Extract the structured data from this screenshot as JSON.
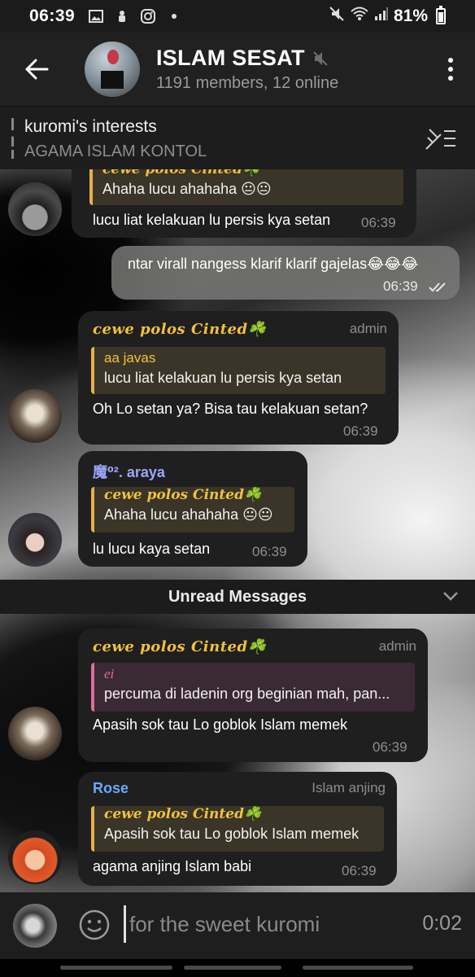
{
  "status_bar": {
    "time": "06:39",
    "icons_left": [
      "image-icon",
      "android-icon",
      "instagram-icon",
      "dot-icon"
    ],
    "battery": "81%"
  },
  "header": {
    "title": "ISLAM SESAT",
    "subtitle": "1191 members, 12 online"
  },
  "pinned": {
    "title": "kuromi's interests",
    "text": "AGAMA ISLAM KONTOL"
  },
  "messages": [
    {
      "sender": "",
      "reply_name": "cewe polos Cinted☘️",
      "reply_text": "Ahaha lucu ahahaha 😐😐",
      "text": "lucu liat kelakuan lu persis kya setan",
      "time": "06:39"
    },
    {
      "outgoing": true,
      "text": "ntar virall nangess klarif klarif gajelas😂😂😂",
      "time": "06:39"
    },
    {
      "sender": "cewe polos Cinted☘️",
      "role": "admin",
      "reply_name": "aa javas",
      "reply_text": "lucu liat kelakuan lu persis kya setan",
      "text": "Oh Lo setan ya? Bisa tau kelakuan setan?",
      "time": "06:39"
    },
    {
      "sender": "魔⁰². araya",
      "reply_name": "cewe polos Cinted☘️",
      "reply_text": "Ahaha lucu ahahaha 😐😐",
      "text": "lu lucu kaya setan",
      "time": "06:39"
    },
    {
      "sender": "cewe polos Cinted☘️",
      "role": "admin",
      "reply_name": "ei",
      "reply_text": "percuma di ladenin org beginian mah,  pan...",
      "text": "Apasih sok tau Lo goblok Islam memek",
      "time": "06:39"
    },
    {
      "sender": "Rose",
      "role": "Islam anjing",
      "reply_name": "cewe polos Cinted☘️",
      "reply_text": "Apasih sok tau Lo goblok Islam memek",
      "text": "agama anjing Islam babi",
      "time": "06:39"
    }
  ],
  "unread_label": "Unread Messages",
  "input": {
    "text": "for the sweet kuromi",
    "record_time": "0:02"
  },
  "colors": {
    "header_bg": "#212121",
    "bubble_bg": "#1f1f1f",
    "outgoing_bg": "#7a7a76",
    "gold_name": "#f0c23b",
    "reply_accent": "#e6b14a",
    "pink_accent": "#e36a9e",
    "purple_name": "#9ea7ff",
    "blue_name": "#6aa9ff"
  }
}
